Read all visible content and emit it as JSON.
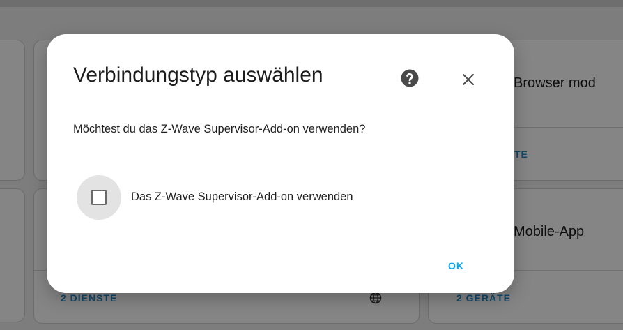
{
  "background": {
    "card_browser_title": "Browser mod",
    "card_browser_link": "TE",
    "card_mobile_title": "Mobile-App",
    "card_services_link": "2 DIENSTE",
    "card_devices_link": "2 GERÄTE"
  },
  "dialog": {
    "title": "Verbindungstyp auswählen",
    "question": "Möchtest du das Z-Wave Supervisor-Add-on verwenden?",
    "checkbox_label": "Das Z-Wave Supervisor-Add-on verwenden",
    "checkbox_checked": false,
    "ok_label": "OK"
  },
  "colors": {
    "accent": "#03a9f4",
    "dialog_bg": "#ffffff",
    "scrim": "#7d7d7d"
  },
  "icons": {
    "help": "help-circle-icon",
    "close": "close-icon",
    "globe": "globe-icon"
  }
}
